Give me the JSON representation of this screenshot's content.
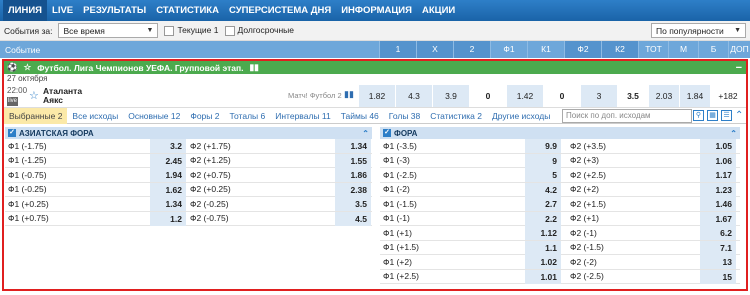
{
  "nav": [
    "ЛИНИЯ",
    "LIVE",
    "РЕЗУЛЬТАТЫ",
    "СТАТИСТИКА",
    "СУПЕРСИСТЕМА ДНЯ",
    "ИНФОРМАЦИЯ",
    "АКЦИИ"
  ],
  "filter": {
    "label": "События за:",
    "period": "Все время",
    "current": "Текущие 1",
    "longterm": "Долгосрочные",
    "sort": "По популярности"
  },
  "header": {
    "event": "Событие",
    "cols": [
      "1",
      "X",
      "2",
      "Ф1",
      "К1",
      "Ф2",
      "К2",
      "ТОТ",
      "М",
      "Б",
      "ДОП"
    ]
  },
  "league": {
    "title": "Футбол. Лига Чемпионов УЕФА. Групповой этап."
  },
  "date": "27 октября",
  "match": {
    "time": "22:00",
    "live": "live",
    "team1": "Аталанта",
    "team2": "Аякс",
    "extra": "Матч! Футбол 2",
    "odds": [
      "1.82",
      "4.3",
      "3.9",
      "0",
      "1.42",
      "0",
      "3",
      "3.5",
      "2.03",
      "1.84",
      "+182"
    ]
  },
  "subtabs": [
    "Выбранные 2",
    "Все исходы",
    "Основные 12",
    "Форы 2",
    "Тоталы 6",
    "Интервалы 11",
    "Таймы 46",
    "Голы 38",
    "Статистика 2",
    "Другие исходы"
  ],
  "search_placeholder": "Поиск по доп. исходам",
  "asian": {
    "title": "АЗИАТСКАЯ ФОРА",
    "rows": [
      [
        "Ф1 (-1.75)",
        "3.2",
        "Ф2 (+1.75)",
        "1.34"
      ],
      [
        "Ф1 (-1.25)",
        "2.45",
        "Ф2 (+1.25)",
        "1.55"
      ],
      [
        "Ф1 (-0.75)",
        "1.94",
        "Ф2 (+0.75)",
        "1.86"
      ],
      [
        "Ф1 (-0.25)",
        "1.62",
        "Ф2 (+0.25)",
        "2.38"
      ],
      [
        "Ф1 (+0.25)",
        "1.34",
        "Ф2 (-0.25)",
        "3.5"
      ],
      [
        "Ф1 (+0.75)",
        "1.2",
        "Ф2 (-0.75)",
        "4.5"
      ]
    ]
  },
  "handicap": {
    "title": "ФОРА",
    "rows": [
      [
        "Ф1 (-3.5)",
        "9.9",
        "Ф2 (+3.5)",
        "1.05"
      ],
      [
        "Ф1 (-3)",
        "9",
        "Ф2 (+3)",
        "1.06"
      ],
      [
        "Ф1 (-2.5)",
        "5",
        "Ф2 (+2.5)",
        "1.17"
      ],
      [
        "Ф1 (-2)",
        "4.2",
        "Ф2 (+2)",
        "1.23"
      ],
      [
        "Ф1 (-1.5)",
        "2.7",
        "Ф2 (+1.5)",
        "1.46"
      ],
      [
        "Ф1 (-1)",
        "2.2",
        "Ф2 (+1)",
        "1.67"
      ],
      [
        "Ф1 (+1)",
        "1.12",
        "Ф2 (-1)",
        "6.2"
      ],
      [
        "Ф1 (+1.5)",
        "1.1",
        "Ф2 (-1.5)",
        "7.1"
      ],
      [
        "Ф1 (+2)",
        "1.02",
        "Ф2 (-2)",
        "13"
      ],
      [
        "Ф1 (+2.5)",
        "1.01",
        "Ф2 (-2.5)",
        "15"
      ]
    ]
  }
}
